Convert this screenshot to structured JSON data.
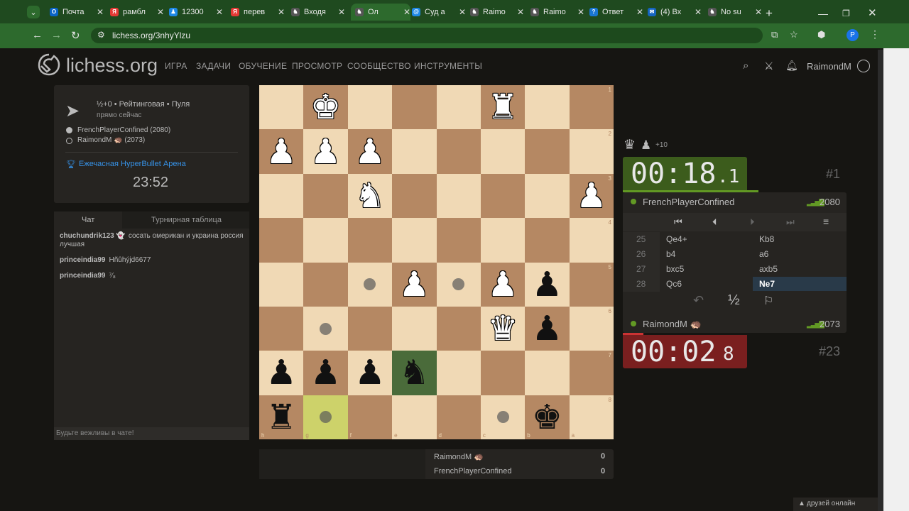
{
  "browser": {
    "tabs": [
      {
        "label": "Почта",
        "color": "#0a64c8",
        "glyph": "O"
      },
      {
        "label": "рамбл",
        "color": "#e53935",
        "glyph": "Я"
      },
      {
        "label": "12300",
        "color": "#1e88e5",
        "glyph": "♟"
      },
      {
        "label": "перев",
        "color": "#e53935",
        "glyph": "Я"
      },
      {
        "label": "Входя",
        "color": "#555555",
        "glyph": "♞"
      },
      {
        "label": "Ол",
        "color": "#555555",
        "glyph": "♞"
      },
      {
        "label": "Суд а",
        "color": "#1e88e5",
        "glyph": "@"
      },
      {
        "label": "Raimo",
        "color": "#555555",
        "glyph": "♞"
      },
      {
        "label": "Raimo",
        "color": "#555555",
        "glyph": "♞"
      },
      {
        "label": "Ответ",
        "color": "#1976d2",
        "glyph": "?"
      },
      {
        "label": "(4) Вх",
        "color": "#1565c0",
        "glyph": "✉"
      },
      {
        "label": "No su",
        "color": "#555555",
        "glyph": "♞"
      }
    ],
    "url": "lichess.org/3nhyYlzu",
    "profile_initial": "P"
  },
  "header": {
    "logo_text": "lichess.org",
    "nav": [
      "ИГРА",
      "ЗАДАЧИ",
      "ОБУЧЕНИЕ",
      "ПРОСМОТР",
      "СООБЩЕСТВО",
      "ИНСТРУМЕНТЫ"
    ],
    "username": "RaimondM"
  },
  "game_info": {
    "mode": "½+0 • Рейтинговая • Пуля",
    "time": "прямо сейчас",
    "white": "FrenchPlayerConfined (2080)",
    "black": "RaimondM 🦔 (2073)",
    "tournament": "Ежечасная HyperBullet Арена",
    "tournament_clock": "23:52"
  },
  "chat": {
    "tab_chat": "Чат",
    "tab_table": "Турнирная таблица",
    "messages": [
      {
        "user": "chuchundrik123 👻",
        "text": "сосать омерикан и украина россия лучшая"
      },
      {
        "user": "princeindia99",
        "text": "Hñûhýjd6677"
      },
      {
        "user": "princeindia99",
        "text": "⁷⁄₈"
      }
    ],
    "placeholder": "Будьте вежливы в чате!"
  },
  "board": {
    "files_bottom": [
      "h",
      "g",
      "f",
      "e",
      "d",
      "c",
      "b",
      "a"
    ],
    "ranks_right": [
      "1",
      "2",
      "3",
      "4",
      "5",
      "6",
      "7",
      "8"
    ],
    "pieces": [
      {
        "r": 0,
        "c": 1,
        "p": "♚",
        "side": "w"
      },
      {
        "r": 0,
        "c": 5,
        "p": "♜",
        "side": "w"
      },
      {
        "r": 1,
        "c": 0,
        "p": "♟",
        "side": "w"
      },
      {
        "r": 1,
        "c": 1,
        "p": "♟",
        "side": "w"
      },
      {
        "r": 1,
        "c": 2,
        "p": "♟",
        "side": "w"
      },
      {
        "r": 2,
        "c": 2,
        "p": "♞",
        "side": "w"
      },
      {
        "r": 2,
        "c": 7,
        "p": "♟",
        "side": "w"
      },
      {
        "r": 4,
        "c": 3,
        "p": "♟",
        "side": "w"
      },
      {
        "r": 4,
        "c": 5,
        "p": "♟",
        "side": "w"
      },
      {
        "r": 4,
        "c": 6,
        "p": "♟",
        "side": "b"
      },
      {
        "r": 5,
        "c": 5,
        "p": "♛",
        "side": "w"
      },
      {
        "r": 5,
        "c": 6,
        "p": "♟",
        "side": "b"
      },
      {
        "r": 6,
        "c": 0,
        "p": "♟",
        "side": "b"
      },
      {
        "r": 6,
        "c": 1,
        "p": "♟",
        "side": "b"
      },
      {
        "r": 6,
        "c": 2,
        "p": "♟",
        "side": "b"
      },
      {
        "r": 6,
        "c": 3,
        "p": "♞",
        "side": "b"
      },
      {
        "r": 7,
        "c": 0,
        "p": "♜",
        "side": "b"
      },
      {
        "r": 7,
        "c": 6,
        "p": "♚",
        "side": "b"
      }
    ],
    "dots": [
      [
        4,
        2
      ],
      [
        4,
        4
      ],
      [
        5,
        1
      ],
      [
        7,
        1
      ],
      [
        7,
        5
      ]
    ],
    "highlight_selected": [
      6,
      3
    ],
    "highlight_last": [
      7,
      1
    ]
  },
  "right": {
    "material": "+10",
    "top_clock": {
      "main": "00:18",
      "frac": ".1"
    },
    "top_rank": "#1",
    "top_player": "FrenchPlayerConfined",
    "top_rating": "2080",
    "moves": [
      {
        "n": "25",
        "w": "Qe4+",
        "b": "Kb8"
      },
      {
        "n": "26",
        "w": "b4",
        "b": "a6"
      },
      {
        "n": "27",
        "w": "bxc5",
        "b": "axb5"
      },
      {
        "n": "28",
        "w": "Qc6",
        "b": "Ne7"
      }
    ],
    "half": "½",
    "bottom_player": "RaimondM 🦔",
    "bottom_rating": "2073",
    "bottom_clock": {
      "main": "00:02",
      "frac": "8"
    },
    "bottom_rank": "#23"
  },
  "scores": [
    {
      "name": "RaimondM 🦔",
      "score": "0"
    },
    {
      "name": "FrenchPlayerConfined",
      "score": "0"
    }
  ],
  "friends": "друзей онлайн"
}
